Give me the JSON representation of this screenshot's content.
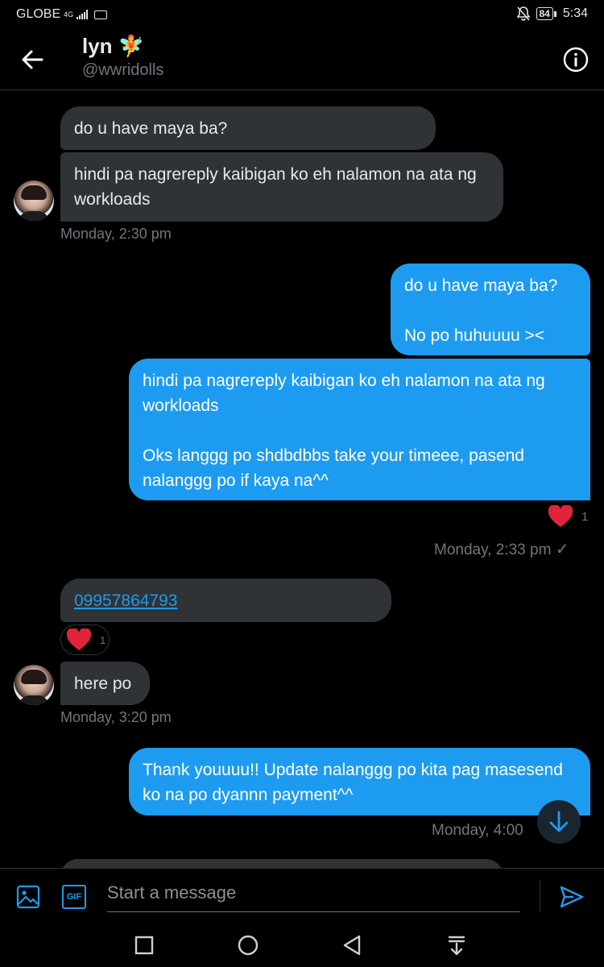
{
  "status": {
    "carrier": "GLOBE",
    "network": "4G",
    "battery": "84",
    "time": "5:34"
  },
  "header": {
    "name": "lyn 🧚",
    "handle": "@wwridolls"
  },
  "messages": [
    {
      "text": "do u have maya ba?"
    },
    {
      "text": "hindi pa nagrereply kaibigan ko eh nalamon na ata ng workloads"
    },
    {
      "meta": "Monday, 2:30 pm"
    },
    {
      "text": "do u have maya ba?\n\nNo po huhuuuu ><"
    },
    {
      "text": "hindi pa nagrereply kaibigan ko eh nalamon na ata ng workloads\n\nOks langgg po shdbdbbs take your timeee, pasend nalanggg po if kaya na^^"
    },
    {
      "meta": "Monday, 2:33 pm",
      "reaction_count": "1"
    },
    {
      "text": "09957864793",
      "reaction_count": "1"
    },
    {
      "text": "here po"
    },
    {
      "meta": "Monday, 3:20 pm"
    },
    {
      "text": "Thank youuuu!! Update nalanggg po kita pag masesend ko na po dyannn payment^^"
    },
    {
      "meta": "Monday, 4:00"
    }
  ],
  "composer": {
    "placeholder": "Start a message",
    "gif_label": "GIF"
  },
  "icons": {
    "back": "arrow-left-icon",
    "info": "info-icon",
    "media": "image-icon",
    "gif": "gif-icon",
    "send": "send-icon",
    "scroll": "arrow-down-icon",
    "heart": "heart-icon",
    "check": "check-icon"
  },
  "colors": {
    "accent": "#1d9bf0",
    "received_bubble": "#2f3336",
    "muted_text": "#71767b",
    "heart": "#f91880"
  }
}
